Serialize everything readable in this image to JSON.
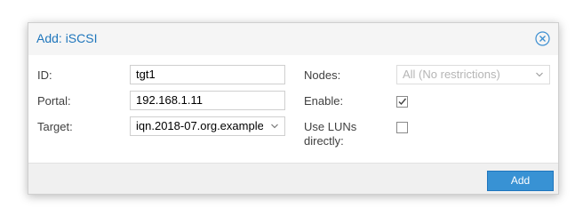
{
  "dialog": {
    "title": "Add: iSCSI",
    "close_icon": "close-circle-icon"
  },
  "form": {
    "left": [
      {
        "label": "ID:",
        "value": "tgt1"
      },
      {
        "label": "Portal:",
        "value": "192.168.1.11"
      },
      {
        "label": "Target:",
        "value": "iqn.2018-07.org.example"
      }
    ],
    "right": {
      "nodes_label": "Nodes:",
      "nodes_value": "All (No restrictions)",
      "enable_label": "Enable:",
      "enable_checked": true,
      "use_luns_label_line1": "Use LUNs",
      "use_luns_label_line2": "directly:",
      "use_luns_checked": false
    }
  },
  "footer": {
    "add_label": "Add"
  },
  "colors": {
    "title": "#1f76bc",
    "primary_button": "#3892d4"
  }
}
